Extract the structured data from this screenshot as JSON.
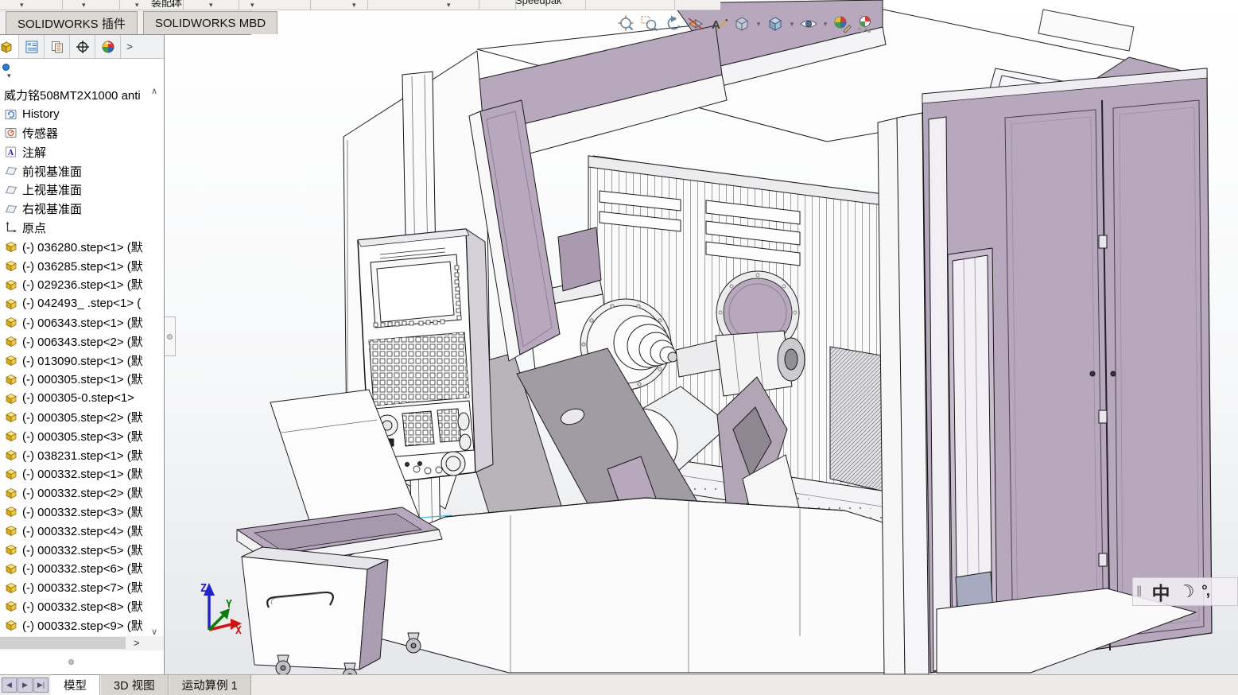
{
  "window": {
    "toolbar_fragments": [
      "装配体",
      "Speedpak"
    ],
    "addin_tabs": [
      "SOLIDWORKS 插件",
      "SOLIDWORKS MBD"
    ]
  },
  "feature_panel": {
    "manager_tab_icons": [
      "featuremanager-design-tree",
      "property-manager",
      "configuration-manager",
      "dimxpert-manager",
      "display-manager"
    ],
    "expand_icon": ">",
    "filter_caret": "▾",
    "scroll_up_icon": "∧",
    "scroll_down_icon": "∨",
    "root_label": "威力铭508MT2X1000 anti",
    "items": [
      {
        "icon": "history",
        "label": "History"
      },
      {
        "icon": "sensors",
        "label": "传感器"
      },
      {
        "icon": "annotations",
        "label": "注解"
      },
      {
        "icon": "plane",
        "label": "前视基准面"
      },
      {
        "icon": "plane",
        "label": "上视基准面"
      },
      {
        "icon": "plane",
        "label": "右视基准面"
      },
      {
        "icon": "origin",
        "label": "原点"
      },
      {
        "icon": "part",
        "label": "(-) 036280.step<1> (默"
      },
      {
        "icon": "part",
        "label": "(-) 036285.step<1> (默"
      },
      {
        "icon": "part",
        "label": "(-) 029236.step<1> (默"
      },
      {
        "icon": "part",
        "label": "(-) 042493_ .step<1> ("
      },
      {
        "icon": "part",
        "label": "(-) 006343.step<1> (默"
      },
      {
        "icon": "part",
        "label": "(-) 006343.step<2> (默"
      },
      {
        "icon": "part",
        "label": "(-) 013090.step<1> (默"
      },
      {
        "icon": "part",
        "label": "(-) 000305.step<1> (默"
      },
      {
        "icon": "part",
        "label": "(-) 000305-0.step<1>"
      },
      {
        "icon": "part",
        "label": "(-) 000305.step<2> (默"
      },
      {
        "icon": "part",
        "label": "(-) 000305.step<3> (默"
      },
      {
        "icon": "part",
        "label": "(-) 038231.step<1> (默"
      },
      {
        "icon": "part",
        "label": "(-) 000332.step<1> (默"
      },
      {
        "icon": "part",
        "label": "(-) 000332.step<2> (默"
      },
      {
        "icon": "part",
        "label": "(-) 000332.step<3> (默"
      },
      {
        "icon": "part",
        "label": "(-) 000332.step<4> (默"
      },
      {
        "icon": "part",
        "label": "(-) 000332.step<5> (默"
      },
      {
        "icon": "part",
        "label": "(-) 000332.step<6> (默"
      },
      {
        "icon": "part",
        "label": "(-) 000332.step<7> (默"
      },
      {
        "icon": "part",
        "label": "(-) 000332.step<8> (默"
      },
      {
        "icon": "part",
        "label": "(-) 000332.step<9> (默"
      }
    ]
  },
  "headsup_icons": [
    "zoom-to-fit",
    "zoom-to-area",
    "previous-view",
    "section-view",
    "annotation-visibility",
    "view-orientation",
    "display-style",
    "hide-show-items",
    "edit-appearance",
    "apply-scene"
  ],
  "viewport": {
    "triad": {
      "x": "X",
      "y": "Y",
      "z": "Z"
    },
    "ime_bar": {
      "grip": "‖",
      "language": "中",
      "moon": "☽",
      "punctuation": "°,"
    }
  },
  "bottom_bar": {
    "nav_icons": [
      "◀",
      "▶",
      "▶|"
    ],
    "tabs": [
      {
        "label": "模型",
        "active": true
      },
      {
        "label": "3D 视图",
        "active": false
      },
      {
        "label": "运动算例 1",
        "active": false
      }
    ]
  },
  "colors": {
    "machine_lavender": "#b7a8bd",
    "machine_gray": "#a19ba3",
    "edge": "#1c1c1c",
    "triad_x": "#cc1414",
    "triad_y": "#0b7d0b",
    "triad_z": "#2323cc",
    "sketch_blue": "#45b7d9"
  }
}
